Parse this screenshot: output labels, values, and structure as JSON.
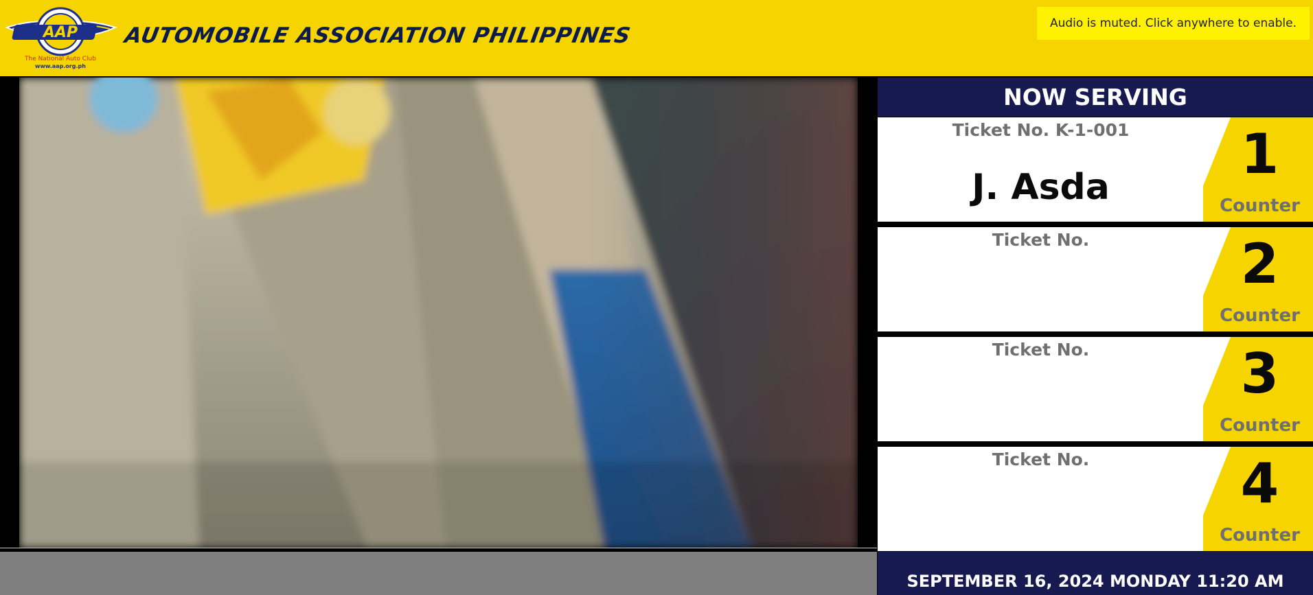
{
  "header": {
    "logo": {
      "icon": "aap-winged-emblem-icon",
      "wordmark": "AAP",
      "tagline": "The National Auto Club",
      "url": "www.aap.org.ph"
    },
    "title": "AUTOMOBILE ASSOCIATION PHILIPPINES",
    "audio_notice": "Audio is muted. Click anywhere to enable."
  },
  "panel": {
    "heading": "NOW SERVING",
    "slots": [
      {
        "ticket": "Ticket No. K-1-001",
        "name": "J. Asda",
        "counter": "1",
        "counter_label": "Counter"
      },
      {
        "ticket": "Ticket No.",
        "name": "",
        "counter": "2",
        "counter_label": "Counter"
      },
      {
        "ticket": "Ticket No.",
        "name": "",
        "counter": "3",
        "counter_label": "Counter"
      },
      {
        "ticket": "Ticket No.",
        "name": "",
        "counter": "4",
        "counter_label": "Counter"
      }
    ]
  },
  "footer": {
    "datetime": "SEPTEMBER 16, 2024 MONDAY 11:20 AM"
  },
  "colors": {
    "brand_yellow": "#f6d400",
    "navy": "#161a50",
    "notice_yellow": "#fff200",
    "gray_text": "#6f6f6f"
  }
}
